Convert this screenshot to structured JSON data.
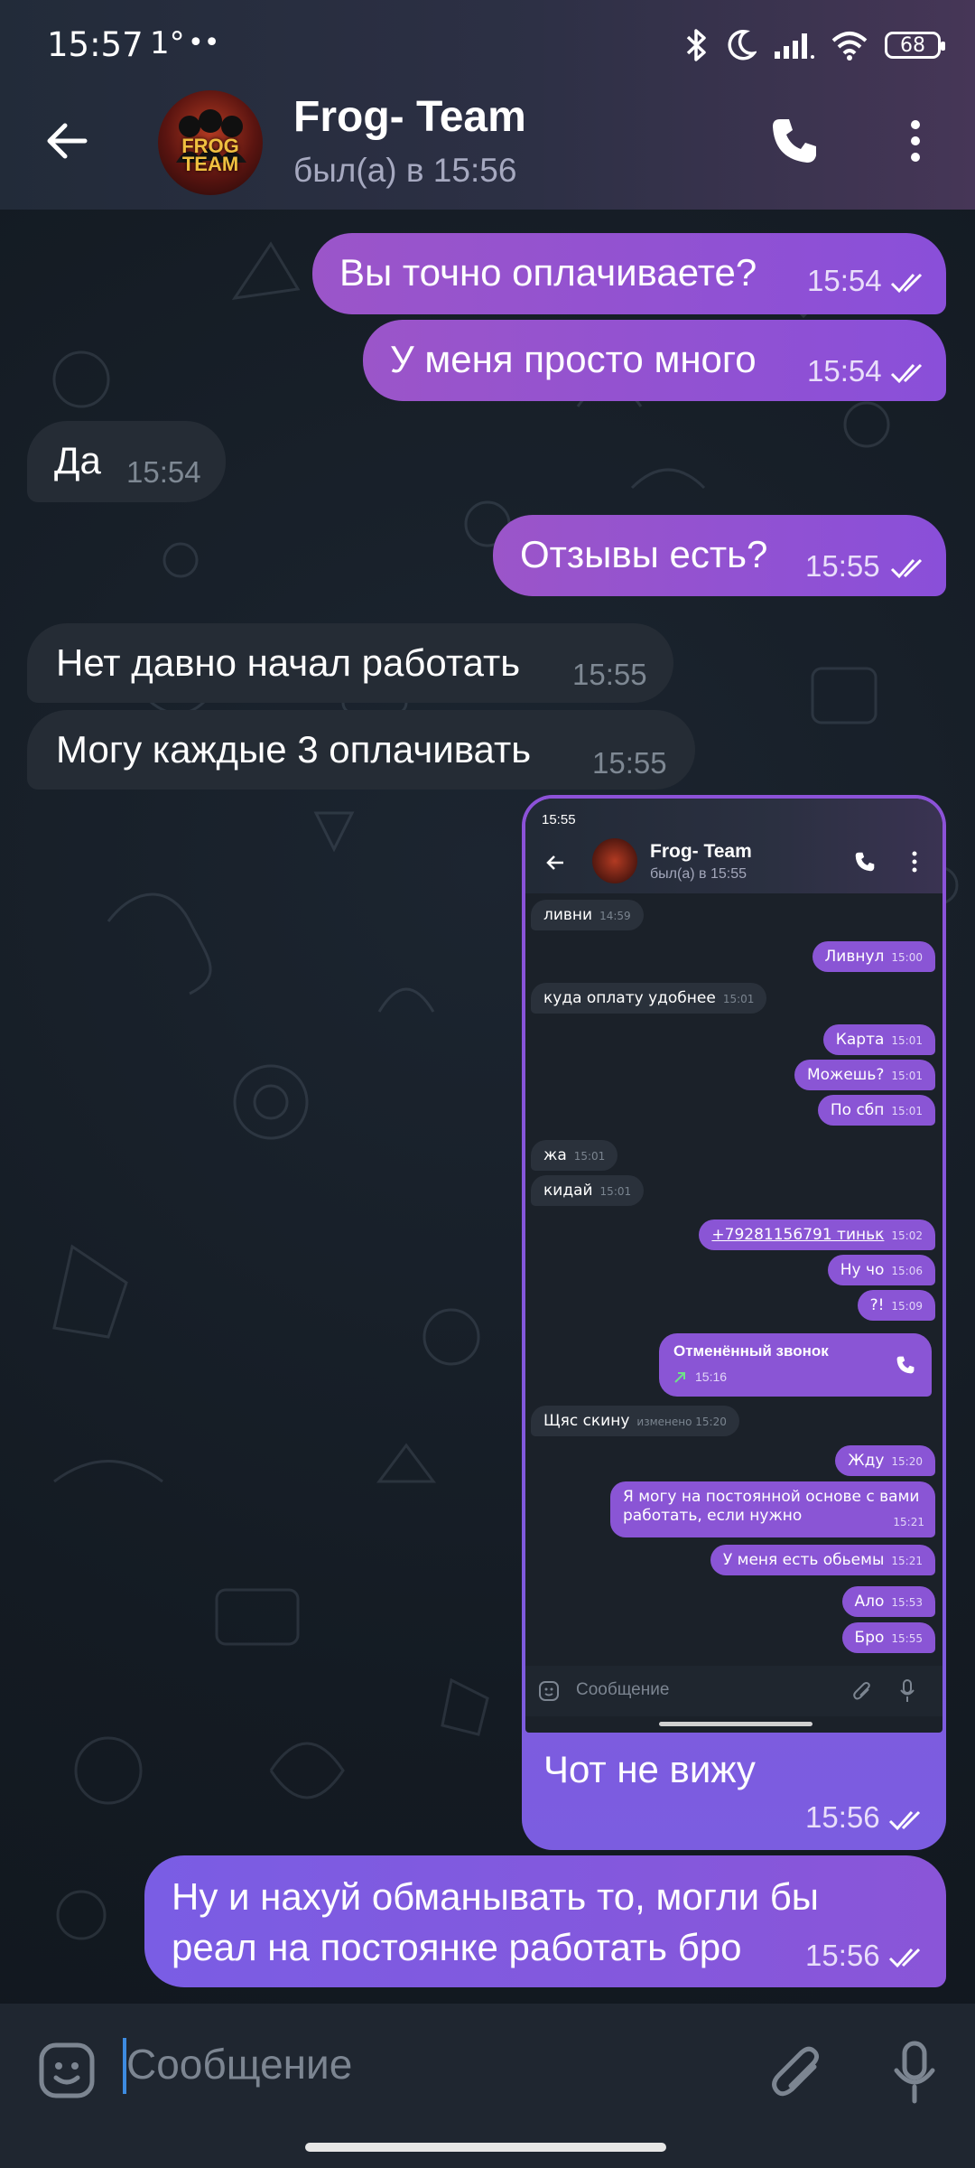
{
  "status_bar": {
    "time": "15:57",
    "temperature": "1°",
    "extra": "••",
    "battery": "68",
    "icons": [
      "bluetooth-icon",
      "moon-icon",
      "signal-icon",
      "wifi-icon",
      "battery-icon"
    ]
  },
  "header": {
    "title": "Frog- Team",
    "subtitle": "был(а) в 15:56",
    "avatar_text": "FROG TEAM"
  },
  "messages": [
    {
      "dir": "out",
      "text": "Вы точно оплачиваете?",
      "time": "15:54"
    },
    {
      "dir": "out",
      "text": "У меня просто много",
      "time": "15:54"
    },
    {
      "dir": "in",
      "text": "Да",
      "time": "15:54"
    },
    {
      "dir": "out",
      "text": "Отзывы есть?",
      "time": "15:55"
    },
    {
      "dir": "in",
      "text": "Нет давно начал работать",
      "time": "15:55"
    },
    {
      "dir": "in",
      "text": "Могу каждые 3 оплачивать",
      "time": "15:55"
    },
    {
      "dir": "out",
      "text": "Чот не вижу",
      "time": "15:56",
      "has_image": true
    },
    {
      "dir": "out",
      "text_line1": "Ну и нахуй обманывать то, могли бы",
      "text_line2": "реал на постоянке работать бро",
      "time": "15:56"
    }
  ],
  "embedded_screenshot": {
    "status_time": "15:55",
    "title": "Frog- Team",
    "subtitle": "был(а) в 15:55",
    "messages": [
      {
        "dir": "in",
        "text": "ливни",
        "time": "14:59"
      },
      {
        "dir": "out",
        "text": "Ливнул",
        "time": "15:00"
      },
      {
        "dir": "in",
        "text": "куда оплату удобнее",
        "time": "15:01"
      },
      {
        "dir": "out",
        "text": "Карта",
        "time": "15:01"
      },
      {
        "dir": "out",
        "text": "Можешь?",
        "time": "15:01"
      },
      {
        "dir": "out",
        "text": "По сбп",
        "time": "15:01"
      },
      {
        "dir": "in",
        "text": "жа",
        "time": "15:01"
      },
      {
        "dir": "in",
        "text": "кидай",
        "time": "15:01"
      },
      {
        "dir": "out",
        "text": "+79281156791 тиньк",
        "time": "15:02"
      },
      {
        "dir": "out",
        "text": "Ну чо",
        "time": "15:06"
      },
      {
        "dir": "out",
        "text": "?!",
        "time": "15:09"
      },
      {
        "dir": "in",
        "text": "Щяс скину",
        "time": "изменено 15:20"
      },
      {
        "dir": "out",
        "text": "Жду",
        "time": "15:20"
      },
      {
        "dir": "out",
        "text_line1": "Я могу на постоянной основе с вами",
        "text_line2": "работать, если нужно",
        "time": "15:21"
      },
      {
        "dir": "out",
        "text": "У меня есть обьемы",
        "time": "15:21"
      },
      {
        "dir": "out",
        "text": "Ало",
        "time": "15:53"
      },
      {
        "dir": "out",
        "text": "Бро",
        "time": "15:55"
      }
    ],
    "call": {
      "label": "Отменённый звонок",
      "time": "15:16"
    },
    "input_placeholder": "Сообщение"
  },
  "input": {
    "placeholder": "Сообщение"
  },
  "colors": {
    "outgoing_bubble": "#8a4fd9",
    "incoming_bubble": "#252c35",
    "background": "#141b23",
    "header": "#2d3045"
  }
}
